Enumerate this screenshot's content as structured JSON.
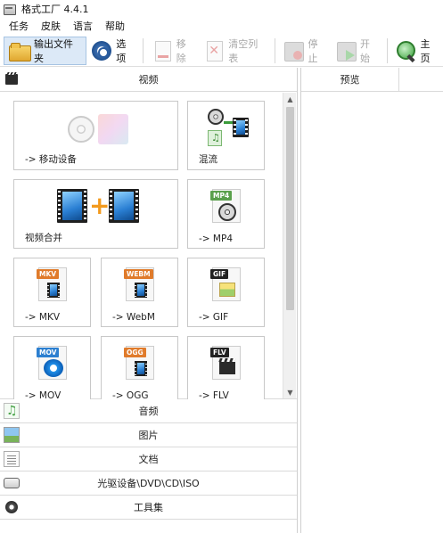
{
  "window": {
    "title": "格式工厂 4.4.1"
  },
  "menu": [
    "任务",
    "皮肤",
    "语言",
    "帮助"
  ],
  "toolbar": {
    "output_folder": "输出文件夹",
    "options": "选项",
    "remove": "移除",
    "clear_list": "清空列表",
    "stop": "停止",
    "start": "开始",
    "home": "主页"
  },
  "categories": {
    "video": "视频",
    "audio": "音频",
    "picture": "图片",
    "document": "文档",
    "optical": "光驱设备\\DVD\\CD\\ISO",
    "tools": "工具集"
  },
  "video_tiles": {
    "mobile": "-> 移动设备",
    "mix": "混流",
    "merge": "视频合并",
    "mp4": "-> MP4",
    "mkv": "-> MKV",
    "webm": "-> WebM",
    "gif": "-> GIF",
    "mov": "-> MOV",
    "ogg": "-> OGG",
    "flv": "-> FLV"
  },
  "format_badges": {
    "mp4": "MP4",
    "mkv": "MKV",
    "webm": "WEBM",
    "gif": "GIF",
    "mov": "MOV",
    "ogg": "OGG",
    "flv": "FLV"
  },
  "preview": {
    "column_preview": "预览"
  },
  "colors": {
    "toolbar_active_bg": "#dce9f7",
    "disabled_text": "#a8a8a8",
    "accent_blue": "#2a7fd3",
    "plus_orange": "#f39a1e"
  }
}
